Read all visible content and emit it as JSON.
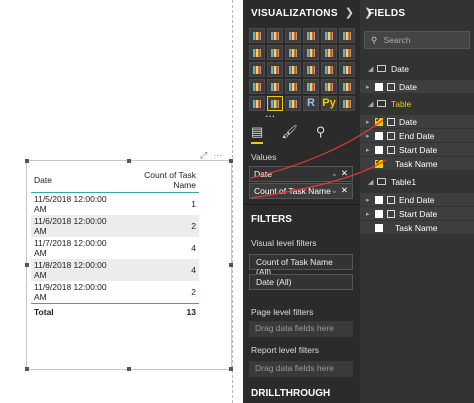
{
  "table_visual": {
    "columns": [
      "Date",
      "Count of Task Name"
    ],
    "rows": [
      {
        "date": "11/5/2018 12:00:00 AM",
        "count": "1"
      },
      {
        "date": "11/6/2018 12:00:00 AM",
        "count": "2"
      },
      {
        "date": "11/7/2018 12:00:00 AM",
        "count": "4"
      },
      {
        "date": "11/8/2018 12:00:00 AM",
        "count": "4"
      },
      {
        "date": "11/9/2018 12:00:00 AM",
        "count": "2"
      }
    ],
    "total_label": "Total",
    "total_value": "13",
    "header_icons": [
      "focus-mode-icon",
      "more-options-icon"
    ]
  },
  "visualizations": {
    "title": "VISUALIZATIONS",
    "more_label": "...",
    "r_label": "R",
    "py_label": "Py",
    "values_label": "Values",
    "value_wells": [
      {
        "label": "Date"
      },
      {
        "label": "Count of Task Name"
      }
    ],
    "filters_title": "FILTERS",
    "visual_filters_label": "Visual level filters",
    "visual_filters": [
      "Count of Task Name (All)",
      "Date (All)"
    ],
    "page_filters_label": "Page level filters",
    "report_filters_label": "Report level filters",
    "drop_hint": "Drag data fields here",
    "drillthrough_label": "DRILLTHROUGH"
  },
  "fields": {
    "title": "FIELDS",
    "search_placeholder": "Search",
    "tables": [
      {
        "name": "Date",
        "highlight": false,
        "fields": [
          {
            "name": "Date",
            "checked": false
          }
        ]
      },
      {
        "name": "Table",
        "highlight": true,
        "fields": [
          {
            "name": "Date",
            "checked": true
          },
          {
            "name": "End Date",
            "checked": false
          },
          {
            "name": "Start Date",
            "checked": false
          },
          {
            "name": "Task Name",
            "checked": true
          }
        ]
      },
      {
        "name": "Table1",
        "highlight": false,
        "fields": [
          {
            "name": "End Date",
            "checked": false
          },
          {
            "name": "Start Date",
            "checked": false
          },
          {
            "name": "Task Name",
            "checked": false
          }
        ]
      }
    ]
  },
  "colors": {
    "accent": "#f2c811",
    "annotation": "#e53935",
    "table_rule": "#3aa6a6"
  }
}
